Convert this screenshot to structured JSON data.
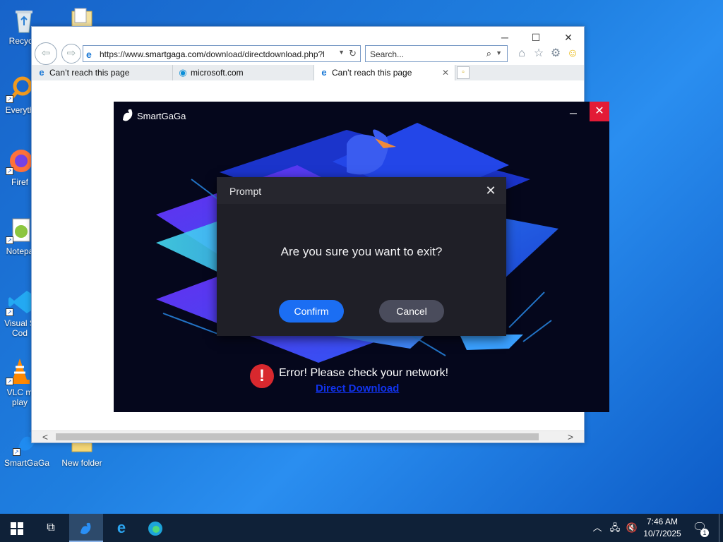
{
  "desktop": {
    "icons": [
      {
        "label": "Recycle"
      },
      {
        "label": "Everyth"
      },
      {
        "label": "Firef"
      },
      {
        "label": "Notepa"
      },
      {
        "label": "Visual S\nCod"
      },
      {
        "label": "VLC m\nplay"
      },
      {
        "label": "SmartGaGa"
      },
      {
        "label": "New folder"
      }
    ]
  },
  "browser": {
    "url_prefix": "https://www.",
    "url_domain": "smartgaga.com",
    "url_path": "/download/directdownload.php?l",
    "search_placeholder": "Search...",
    "tabs": [
      {
        "label": "Can’t reach this page",
        "icon": "ie-icon"
      },
      {
        "label": "microsoft.com",
        "icon": "edge-icon"
      },
      {
        "label": "Can’t reach this page",
        "icon": "ie-icon",
        "active": true
      }
    ]
  },
  "app": {
    "title": "SmartGaGa",
    "error_text": "Error! Please check your network!",
    "direct_link": "Direct Download",
    "accent": "#e31b36"
  },
  "prompt": {
    "title": "Prompt",
    "message": "Are you sure you want to exit?",
    "confirm_label": "Confirm",
    "cancel_label": "Cancel"
  },
  "taskbar": {
    "time": "7:46 AM",
    "date": "10/7/2025",
    "notifications": "1"
  }
}
